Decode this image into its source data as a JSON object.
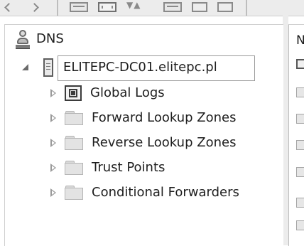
{
  "toolbar": {
    "buttons": [
      {
        "name": "back-button",
        "icon": "back-arrow-icon"
      },
      {
        "name": "forward-button",
        "icon": "forward-arrow-icon"
      },
      {
        "name": "show-hide-console-tree-button",
        "icon": "console-tree-icon"
      },
      {
        "name": "properties-button",
        "icon": "properties-icon"
      },
      {
        "name": "refresh-button",
        "icon": "refresh-icon"
      },
      {
        "name": "export-list-button",
        "icon": "export-icon"
      },
      {
        "name": "help-button",
        "icon": "help-icon"
      }
    ]
  },
  "tree": {
    "root": {
      "label": "DNS",
      "icon": "dns-manager-icon"
    },
    "server": {
      "label": "ELITEPC-DC01.elitepc.pl",
      "icon": "server-icon",
      "expanded": true,
      "selected": true
    },
    "children": [
      {
        "label": "Global Logs",
        "icon": "event-log-icon"
      },
      {
        "label": "Forward Lookup Zones",
        "icon": "folder-icon"
      },
      {
        "label": "Reverse Lookup Zones",
        "icon": "folder-icon"
      },
      {
        "label": "Trust Points",
        "icon": "folder-icon"
      },
      {
        "label": "Conditional Forwarders",
        "icon": "folder-icon"
      }
    ]
  },
  "details_pane": {
    "header_fragment": "N"
  },
  "colors": {
    "window_bg": "#ececec",
    "pane_bg": "#ffffff",
    "selection_border": "#9a9a9a",
    "text": "#1e1e1e"
  }
}
